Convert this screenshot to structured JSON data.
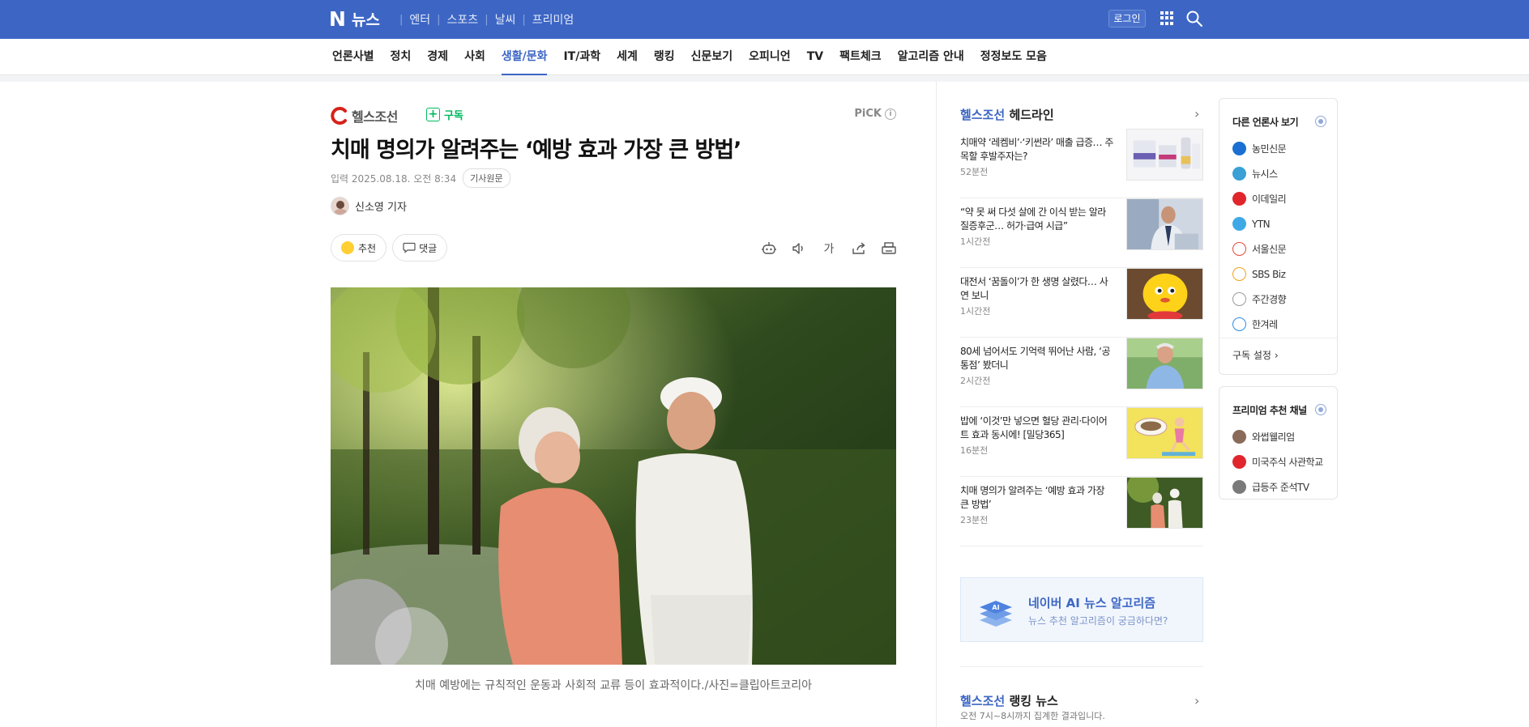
{
  "topbar": {
    "logo_n": "N",
    "logo_text": "뉴스",
    "nav": [
      "엔터",
      "스포츠",
      "날씨",
      "프리미엄"
    ],
    "login": "로그인"
  },
  "catnav": {
    "items": [
      "언론사별",
      "정치",
      "경제",
      "사회",
      "생활/문화",
      "IT/과학",
      "세계",
      "랭킹",
      "신문보기",
      "오피니언",
      "TV",
      "팩트체크",
      "알고리즘 안내",
      "정정보도 모음"
    ],
    "active": "생활/문화"
  },
  "article": {
    "press_name": "헬스조선",
    "subscribe": "구독",
    "pick": "PiCK",
    "pick_info": "i",
    "title": "치매 명의가 알려주는 ‘예방 효과 가장 큰 방법’",
    "date": "입력 2025.08.18. 오전 8:34",
    "original_link": "기사원문",
    "reporter": "신소영 기자",
    "recommend": "추천",
    "comment": "댓글",
    "font_tool": "가",
    "caption": "치매 예방에는 규칙적인 운동과 사회적 교류 등이 효과적이다./사진=클립아트코리아"
  },
  "headlines": {
    "brand": "헬스조선",
    "title": "헤드라인",
    "items": [
      {
        "title": "치매약 ‘레켐비’·‘키썬라’ 매출 급증… 주목할 후발주자는?",
        "time": "52분전",
        "thumb": "medicine"
      },
      {
        "title": "“약 못 써 다섯 살에 간 이식 받는 알라질증후군… 허가·급여 시급”",
        "time": "1시간전",
        "thumb": "doctor"
      },
      {
        "title": "대전서 ‘꿈돌이’가 한 생명 살렸다… 사연 보니",
        "time": "1시간전",
        "thumb": "mascot"
      },
      {
        "title": "80세 넘어서도 기억력 뛰어난 사람, ‘공통점’ 봤더니",
        "time": "2시간전",
        "thumb": "elder"
      },
      {
        "title": "밥에 ‘이것’만 넣으면 혈당 관리·다이어트 효과 동시에! [밀당365]",
        "time": "16분전",
        "thumb": "rice"
      },
      {
        "title": "치매 명의가 알려주는 ‘예방 효과 가장 큰 방법’",
        "time": "23분전",
        "thumb": "joggers"
      }
    ]
  },
  "ai_banner": {
    "title": "네이버 AI 뉴스 알고리즘",
    "subtitle": "뉴스 추천 알고리즘이 궁금하다면?",
    "icon_label": "AI"
  },
  "ranking": {
    "brand": "헬스조선",
    "title": "랭킹 뉴스",
    "subtitle": "오전 7시~8시까지 집계한 결과입니다."
  },
  "other_press": {
    "title": "다른 언론사 보기",
    "items": [
      {
        "name": "농민신문",
        "color": "#1b6fd2"
      },
      {
        "name": "뉴시스",
        "color": "#3aa0d5"
      },
      {
        "name": "이데일리",
        "color": "#e0262c"
      },
      {
        "name": "YTN",
        "color": "#3fa9e8"
      },
      {
        "name": "서울신문",
        "color": "#e3493a"
      },
      {
        "name": "SBS Biz",
        "color": "#f0a21b"
      },
      {
        "name": "주간경향",
        "color": "#9a9a9a"
      },
      {
        "name": "한겨레",
        "color": "#2f8de4"
      }
    ],
    "settings": "구독 설정"
  },
  "premium": {
    "title": "프리미엄 추천 채널",
    "items": [
      {
        "name": "와썹웰리엄",
        "color": "#8a6a5a"
      },
      {
        "name": "미국주식 사관학교",
        "color": "#e0262c"
      },
      {
        "name": "급등주 준석TV",
        "color": "#7a7a7a"
      }
    ]
  },
  "colors": {
    "brand_blue": "#3d66c4",
    "subscribe_green": "#00b95e"
  }
}
